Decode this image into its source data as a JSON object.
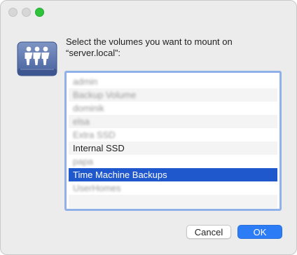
{
  "dialog": {
    "prompt_line1": "Select the volumes you want to mount on",
    "prompt_line2": "“server.local”:",
    "icon": "shared-server-volume-icon"
  },
  "volumes": {
    "items": [
      {
        "label": "admin",
        "blurred": true
      },
      {
        "label": "Backup Volume",
        "blurred": true
      },
      {
        "label": "dominik",
        "blurred": true
      },
      {
        "label": "elsa",
        "blurred": true
      },
      {
        "label": "Extra SSD",
        "blurred": true
      },
      {
        "label": "Internal SSD",
        "blurred": false
      },
      {
        "label": "papa",
        "blurred": true
      },
      {
        "label": "Time Machine Backups",
        "blurred": false,
        "selected": true
      },
      {
        "label": "UserHomes",
        "blurred": true
      }
    ]
  },
  "buttons": {
    "cancel_label": "Cancel",
    "ok_label": "OK"
  },
  "colors": {
    "selection": "#1f57cc",
    "accent": "#2c7cf6",
    "focus_ring": "#8fb0e8"
  }
}
